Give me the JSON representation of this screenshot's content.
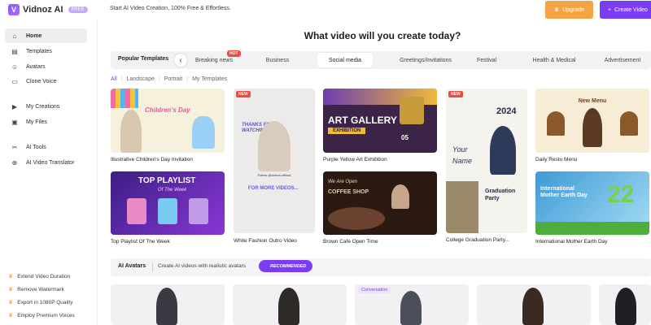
{
  "app": {
    "logo": "Vidnoz AI",
    "logo_badge": "FREE",
    "tagline": "Start AI Video Creation, 100% Free & Effortless.",
    "upgrade_label": "Upgrade",
    "create_label": "Create Video"
  },
  "sidebar": {
    "items": [
      {
        "label": "Home",
        "icon": "home-icon"
      },
      {
        "label": "Templates",
        "icon": "templates-icon"
      },
      {
        "label": "Avatars",
        "icon": "avatar-icon"
      },
      {
        "label": "Clone Voice",
        "icon": "voice-icon"
      },
      {
        "label": "My Creations",
        "icon": "play-icon"
      },
      {
        "label": "My Files",
        "icon": "folder-icon"
      },
      {
        "label": "AI Tools",
        "icon": "tools-icon"
      },
      {
        "label": "AI Video Translator",
        "icon": "translate-icon"
      }
    ],
    "promos": [
      "Extend Video Duration",
      "Remove Watermark",
      "Export in 1080P Quality",
      "Employ Premium Voices"
    ]
  },
  "main": {
    "heading": "What video will you create today?",
    "popular_title": "Popular Templates",
    "tabs": [
      "Breaking news",
      "Business",
      "Social media",
      "Greetings/Invitations",
      "Festival",
      "Health & Medical",
      "Advertisement"
    ],
    "hot_badge": "HOT",
    "filters": [
      "All",
      "Landscape",
      "Portrait",
      "My Templates"
    ],
    "new_badge": "NEW",
    "cards": {
      "c1": {
        "caption": "Illustrative Children's Day Invitation",
        "art_title": "Children's Day"
      },
      "c2": {
        "caption": "Top Playlist Of The Week",
        "art_title": "TOP PLAYLIST",
        "art_sub": "Of The Week"
      },
      "c3": {
        "caption": "White Fashion Outro Video",
        "art_title": "THANKS FOR WATCHING!",
        "art_follow": "Follow @videos.official",
        "art_more": "FOR MORE VIDEOS..."
      },
      "c4": {
        "caption": "Purple Yellow Art Exhibition",
        "art_title": "ART GALLERY",
        "art_sub": "EXHIBITION",
        "art_date": "05"
      },
      "c5": {
        "caption": "Brown Cafe Open Time",
        "art_title": "COFFEE SHOP",
        "art_sub": "We Are Open"
      },
      "c6": {
        "caption": "College Graduation Party...",
        "art_year": "2024",
        "art_name": "Your Name",
        "art_title": "Graduation Party"
      },
      "c7": {
        "caption": "Daily Resto Menu",
        "art_title": "New Menu"
      },
      "c8": {
        "caption": "International Mother Earth Day",
        "art_title": "International Mother Earth Day",
        "art_num": "22"
      }
    },
    "avatars_title": "AI Avatars",
    "avatars_desc": "Create AI videos with realistic avatars",
    "recommended": "RECOMMENDED",
    "conversation_tag": "Conversation"
  }
}
